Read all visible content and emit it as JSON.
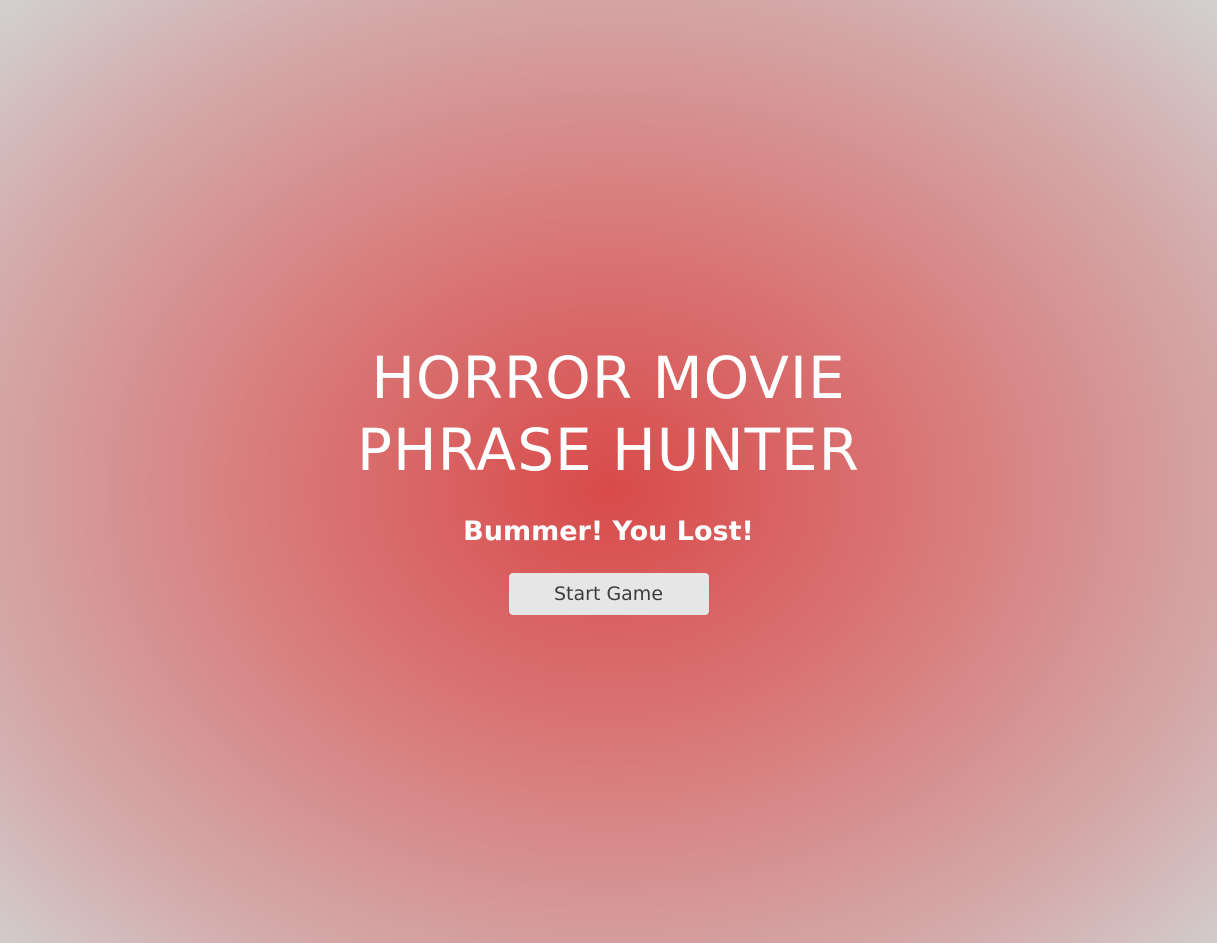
{
  "overlay": {
    "title_line1": "HORROR MOVIE",
    "title_line2": "PHRASE HUNTER",
    "game_over_message": "Bummer! You Lost!",
    "start_button_label": "Start Game",
    "colors": {
      "center": "#d94a4a",
      "edge": "#d2cfcf",
      "text": "#ffffff",
      "button_bg": "#e6e6e6",
      "button_text": "#3c3c3c"
    }
  }
}
